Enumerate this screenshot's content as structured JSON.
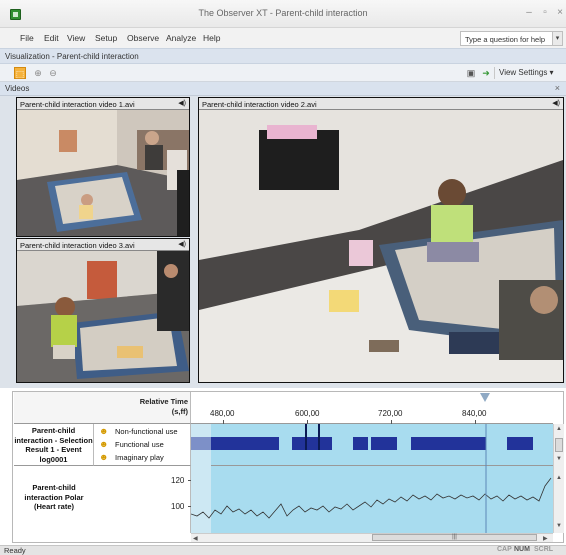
{
  "window": {
    "title": "The Observer XT - Parent-child interaction"
  },
  "menu": {
    "items": [
      "File",
      "Edit",
      "View",
      "Setup",
      "Observe",
      "Analyze",
      "Help"
    ],
    "help_placeholder": "Type a question for help"
  },
  "visualization": {
    "title": "Visualization - Parent-child interaction"
  },
  "toolbar": {
    "view_settings": "View Settings"
  },
  "videos": {
    "header": "Videos",
    "panels": [
      {
        "title": "Parent-child interaction video 1.avi"
      },
      {
        "title": "Parent-child interaction video 2.avi"
      },
      {
        "title": "Parent-child interaction video 3.avi"
      }
    ]
  },
  "timeline": {
    "header_line1": "Relative Time",
    "header_line2": "(s,ff)",
    "ticks": [
      "480,00",
      "600,00",
      "720,00",
      "840,00"
    ],
    "event_row": {
      "label": "Parent-child interaction - Selection Result 1 - Event log0001",
      "behaviors": [
        "Non-functional use",
        "Functional use",
        "Imaginary play"
      ]
    },
    "heart_row": {
      "label": "Parent-child interaction Polar (Heart rate)",
      "y_ticks": [
        "120",
        "100"
      ]
    }
  },
  "status": {
    "ready": "Ready",
    "indicators": [
      "CAP",
      "NUM",
      "SCRL"
    ]
  },
  "colors": {
    "event_bar": "#22339a",
    "track_bg": "#a8dcef",
    "cursor": "#5b87b7"
  }
}
